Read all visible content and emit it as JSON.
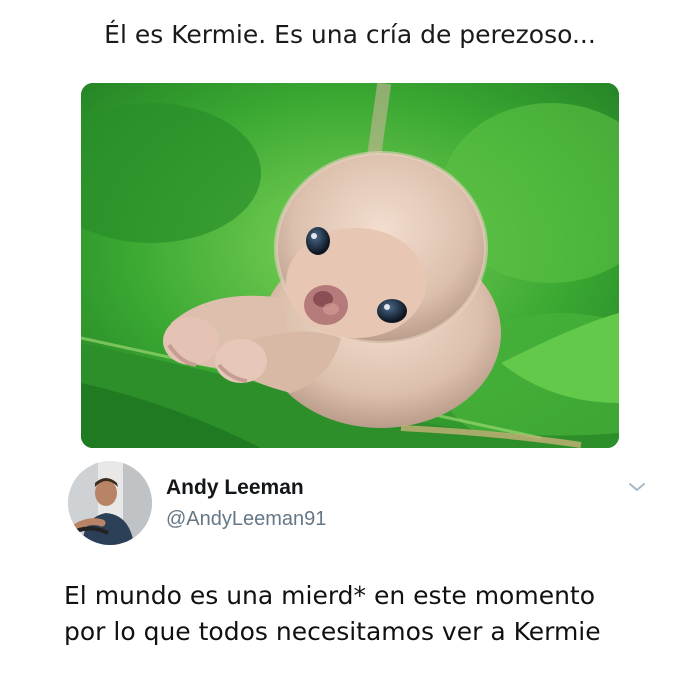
{
  "meme": {
    "top_caption": "Él es Kermie. Es una cría de perezoso..."
  },
  "photo": {
    "subject": "baby sloth on green leaves"
  },
  "tweet": {
    "display_name": "Andy Leeman",
    "handle": "@AndyLeeman91",
    "text_line_1": "El mundo es una mierd* en este momento",
    "text_line_2": "por lo que todos necesitamos ver a Kermie",
    "menu_icon": "chevron-down-icon"
  },
  "colors": {
    "handle_gray": "#657786",
    "name_dark": "#14171a",
    "leaf_green": "#2f9a2d"
  }
}
